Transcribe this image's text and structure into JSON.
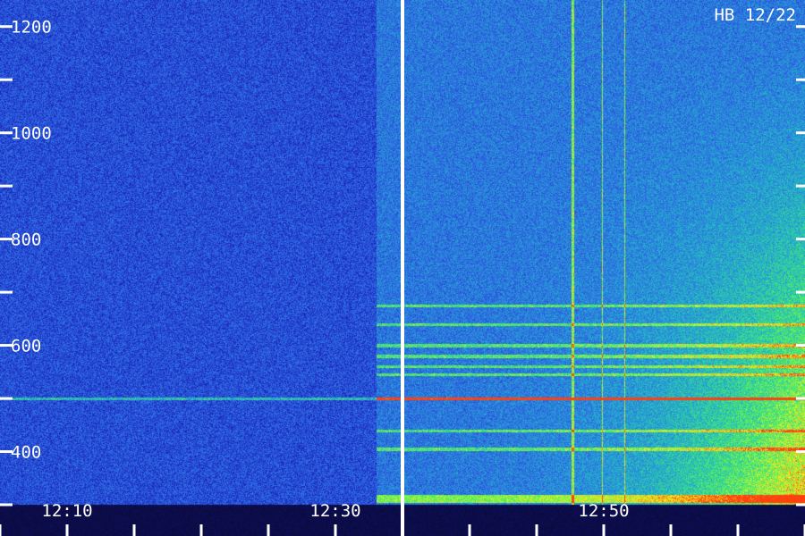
{
  "chart_data": {
    "type": "heatmap",
    "title": "HB 12/22",
    "y_ticks": [
      400,
      600,
      800,
      1000,
      1200
    ],
    "y_range": [
      300,
      1250
    ],
    "x_ticks": [
      "12:10",
      "12:30",
      "12:50"
    ],
    "x_range_minutes": [
      725,
      785
    ],
    "event_marker_time": "12:35",
    "colormap": [
      "#0a0a3a",
      "#1a20b8",
      "#2f6ae6",
      "#22b7c8",
      "#4ff060",
      "#f0f020",
      "#ff4010"
    ],
    "bands_hz": [
      405,
      440,
      500,
      545,
      560,
      580,
      600,
      640,
      675
    ]
  }
}
